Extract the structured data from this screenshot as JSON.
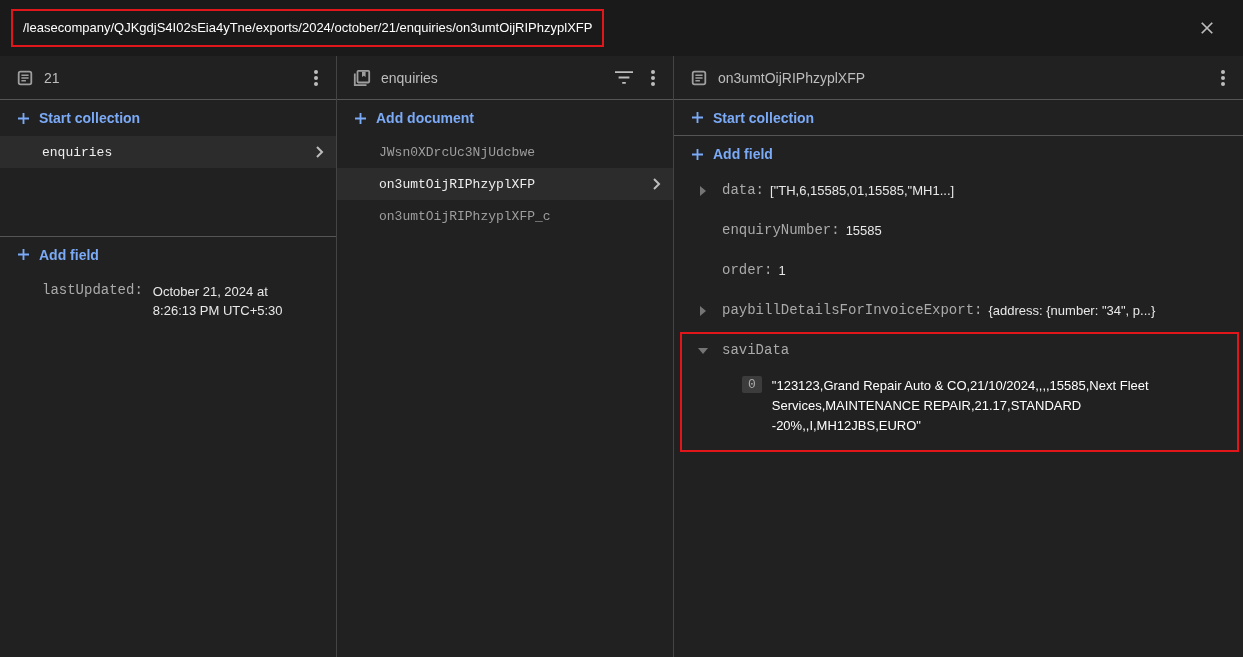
{
  "path_bar": {
    "path": "/leasecompany/QJKgdjS4I02sEia4yTne/exports/2024/october/21/enquiries/on3umtOijRIPhzyplXFP",
    "highlighted": true
  },
  "columns": [
    {
      "kind": "document",
      "title": "21",
      "filter": false,
      "actions": [
        {
          "label": "Start collection"
        }
      ],
      "items": [
        {
          "label": "enquiries",
          "selected": true
        }
      ],
      "add_field": {
        "label": "Add field"
      },
      "fields": [
        {
          "kind": "plain",
          "name": "lastUpdated:",
          "value": "October 21, 2024 at 8:26:13 PM UTC+5:30",
          "highlighted": false
        }
      ]
    },
    {
      "kind": "collection",
      "title": "enquiries",
      "filter": true,
      "actions": [
        {
          "label": "Add document"
        }
      ],
      "items": [
        {
          "label": "JWsn0XDrcUc3NjUdcbwe",
          "selected": false
        },
        {
          "label": "on3umtOijRIPhzyplXFP",
          "selected": true
        },
        {
          "label": "on3umtOijRIPhzyplXFP_c",
          "selected": false
        }
      ]
    },
    {
      "kind": "document",
      "title": "on3umtOijRIPhzyplXFP",
      "filter": false,
      "actions": [
        {
          "label": "Start collection"
        }
      ],
      "add_field": {
        "label": "Add field"
      },
      "fields": [
        {
          "kind": "collapsible",
          "expanded": false,
          "name": "data:",
          "value": "[\"TH,6,15585,01,15585,\"MH1...]",
          "highlighted": false
        },
        {
          "kind": "plain",
          "name": "enquiryNumber:",
          "value": "15585",
          "highlighted": false
        },
        {
          "kind": "plain",
          "name": "order:",
          "value": "1",
          "highlighted": false
        },
        {
          "kind": "collapsible",
          "expanded": false,
          "name": "paybillDetailsForInvoiceExport:",
          "value": "{address: {number: \"34\", p...}",
          "highlighted": false
        },
        {
          "kind": "collapsible",
          "expanded": true,
          "name": "saviData",
          "highlighted": true,
          "children": [
            {
              "index": "0",
              "value": "\"123123,Grand Repair Auto & CO,21/10/2024,,,,15585,Next Fleet Services,MAINTENANCE REPAIR,21.17,STANDARD -20%,,I,MH12JBS,EURO\""
            }
          ]
        }
      ]
    }
  ]
}
